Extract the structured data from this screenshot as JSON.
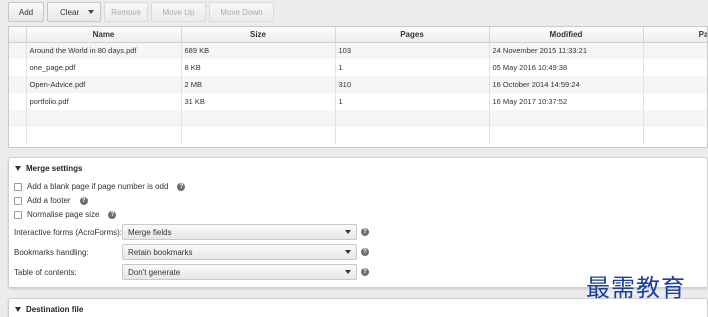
{
  "toolbar": {
    "add_label": "Add",
    "clear_label": "Clear",
    "remove_label": "Remove",
    "move_up_label": "Move Up",
    "move_down_label": "Move Down"
  },
  "table": {
    "columns": [
      "",
      "Name",
      "Size",
      "Pages",
      "Modified",
      "Pag"
    ],
    "rows": [
      {
        "name": "Around the World in 80 days.pdf",
        "size": "689 KB",
        "pages": "103",
        "modified": "24 November 2015 11:33:21"
      },
      {
        "name": "one_page.pdf",
        "size": "8 KB",
        "pages": "1",
        "modified": "05 May 2016 10:49:38"
      },
      {
        "name": "Open-Advice.pdf",
        "size": "2 MB",
        "pages": "310",
        "modified": "16 October 2014 14:59:24"
      },
      {
        "name": "portfolio.pdf",
        "size": "31 KB",
        "pages": "1",
        "modified": "16 May 2017 10:37:52"
      }
    ]
  },
  "merge_settings": {
    "title": "Merge settings",
    "options": [
      {
        "label": "Add a blank page if page number is odd",
        "checked": false
      },
      {
        "label": "Add a footer",
        "checked": false
      },
      {
        "label": "Normalise page size",
        "checked": false
      }
    ],
    "interactive_forms": {
      "label": "Interactive forms (AcroForms):",
      "value": "Merge fields"
    },
    "bookmarks": {
      "label": "Bookmarks handling:",
      "value": "Retain bookmarks"
    },
    "toc": {
      "label": "Table of contents:",
      "value": "Don't generate"
    }
  },
  "destination": {
    "title": "Destination file"
  },
  "watermark": "最需教育",
  "icons": {
    "help": "help-circle-icon",
    "dropdown": "chevron-down-icon",
    "collapse": "triangle-down-icon"
  }
}
